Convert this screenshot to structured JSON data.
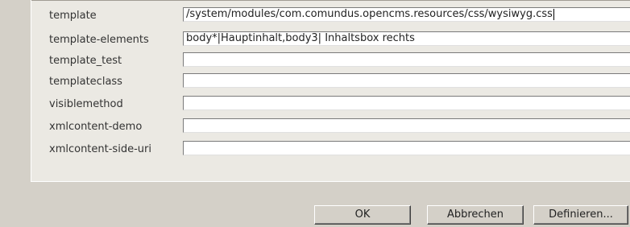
{
  "properties": [
    {
      "label": "template",
      "value": "/system/modules/com.comundus.opencms.resources/css/wysiwyg.css"
    },
    {
      "label": "template-elements",
      "value": "body*|Hauptinhalt,body3| Inhaltsbox rechts"
    },
    {
      "label": "template_test",
      "value": ""
    },
    {
      "label": "templateclass",
      "value": ""
    },
    {
      "label": "visiblemethod",
      "value": ""
    },
    {
      "label": "xmlcontent-demo",
      "value": ""
    },
    {
      "label": "xmlcontent-side-uri",
      "value": ""
    }
  ],
  "buttons": {
    "ok": "OK",
    "cancel": "Abbrechen",
    "define": "Definieren..."
  }
}
